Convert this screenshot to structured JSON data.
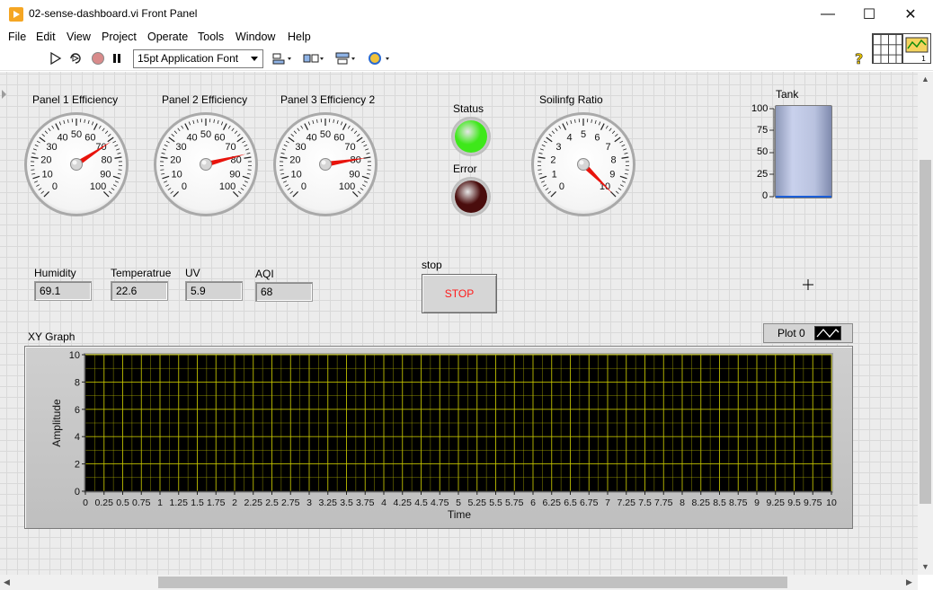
{
  "window": {
    "title": "02-sense-dashboard.vi Front Panel",
    "controls": {
      "minimize": "—",
      "maximize": "☐",
      "close": "✕"
    }
  },
  "menu": [
    "File",
    "Edit",
    "View",
    "Project",
    "Operate",
    "Tools",
    "Window",
    "Help"
  ],
  "toolbar": {
    "font": "15pt Application Font",
    "icons": [
      "run-arrow-icon",
      "run-continuously-icon",
      "abort-icon",
      "pause-icon",
      "align-objects-icon",
      "distribute-objects-icon",
      "resize-objects-icon",
      "reorder-icon",
      "help-icon"
    ]
  },
  "gauges": [
    {
      "label": "Panel 1 Efficiency",
      "min": 0,
      "max": 100,
      "ticks": [
        "0",
        "10",
        "20",
        "30",
        "40",
        "50",
        "60",
        "70",
        "80",
        "90",
        "100"
      ],
      "value": 71
    },
    {
      "label": "Panel 2 Efficiency",
      "min": 0,
      "max": 100,
      "ticks": [
        "0",
        "10",
        "20",
        "30",
        "40",
        "50",
        "60",
        "70",
        "80",
        "90",
        "100"
      ],
      "value": 78
    },
    {
      "label": "Panel 3 Efficiency 2",
      "min": 0,
      "max": 100,
      "ticks": [
        "0",
        "10",
        "20",
        "30",
        "40",
        "50",
        "60",
        "70",
        "80",
        "90",
        "100"
      ],
      "value": 80
    },
    {
      "label": "Soilinfg Ratio",
      "min": 0,
      "max": 10,
      "ticks": [
        "0",
        "1",
        "2",
        "3",
        "4",
        "5",
        "6",
        "7",
        "8",
        "9",
        "10"
      ],
      "value": 10
    }
  ],
  "indicators": {
    "status": {
      "label": "Status",
      "color": "#3ee81a"
    },
    "error": {
      "label": "Error",
      "color": "#4a0d0d"
    }
  },
  "tank": {
    "label": "Tank",
    "ticks": [
      "100",
      "75",
      "50",
      "25",
      "0"
    ],
    "level": 0
  },
  "readouts": [
    {
      "label": "Humidity",
      "value": "69.1"
    },
    {
      "label": "Temperatrue",
      "value": "22.6"
    },
    {
      "label": "UV",
      "value": "5.9"
    },
    {
      "label": "AQI",
      "value": "68"
    }
  ],
  "stop": {
    "label": "stop",
    "button_text": "STOP"
  },
  "graph": {
    "label": "XY Graph",
    "legend": "Plot 0"
  },
  "chart_data": {
    "type": "line",
    "title": "XY Graph",
    "xlabel": "Time",
    "ylabel": "Amplitude",
    "xlim": [
      0,
      10
    ],
    "ylim": [
      0,
      10
    ],
    "x_ticks": [
      "0",
      "0.25",
      "0.5",
      "0.75",
      "1",
      "1.25",
      "1.5",
      "1.75",
      "2",
      "2.25",
      "2.5",
      "2.75",
      "3",
      "3.25",
      "3.5",
      "3.75",
      "4",
      "4.25",
      "4.5",
      "4.75",
      "5",
      "5.25",
      "5.5",
      "5.75",
      "6",
      "6.25",
      "6.5",
      "6.75",
      "7",
      "7.25",
      "7.5",
      "7.75",
      "8",
      "8.25",
      "8.5",
      "8.75",
      "9",
      "9.25",
      "9.5",
      "9.75",
      "10"
    ],
    "y_ticks": [
      "0",
      "2",
      "4",
      "6",
      "8",
      "10"
    ],
    "grid": true,
    "series": [
      {
        "name": "Plot 0",
        "x": [],
        "y": []
      }
    ],
    "colors": {
      "plot_bg": "#000000",
      "grid": "#c8c800"
    }
  }
}
